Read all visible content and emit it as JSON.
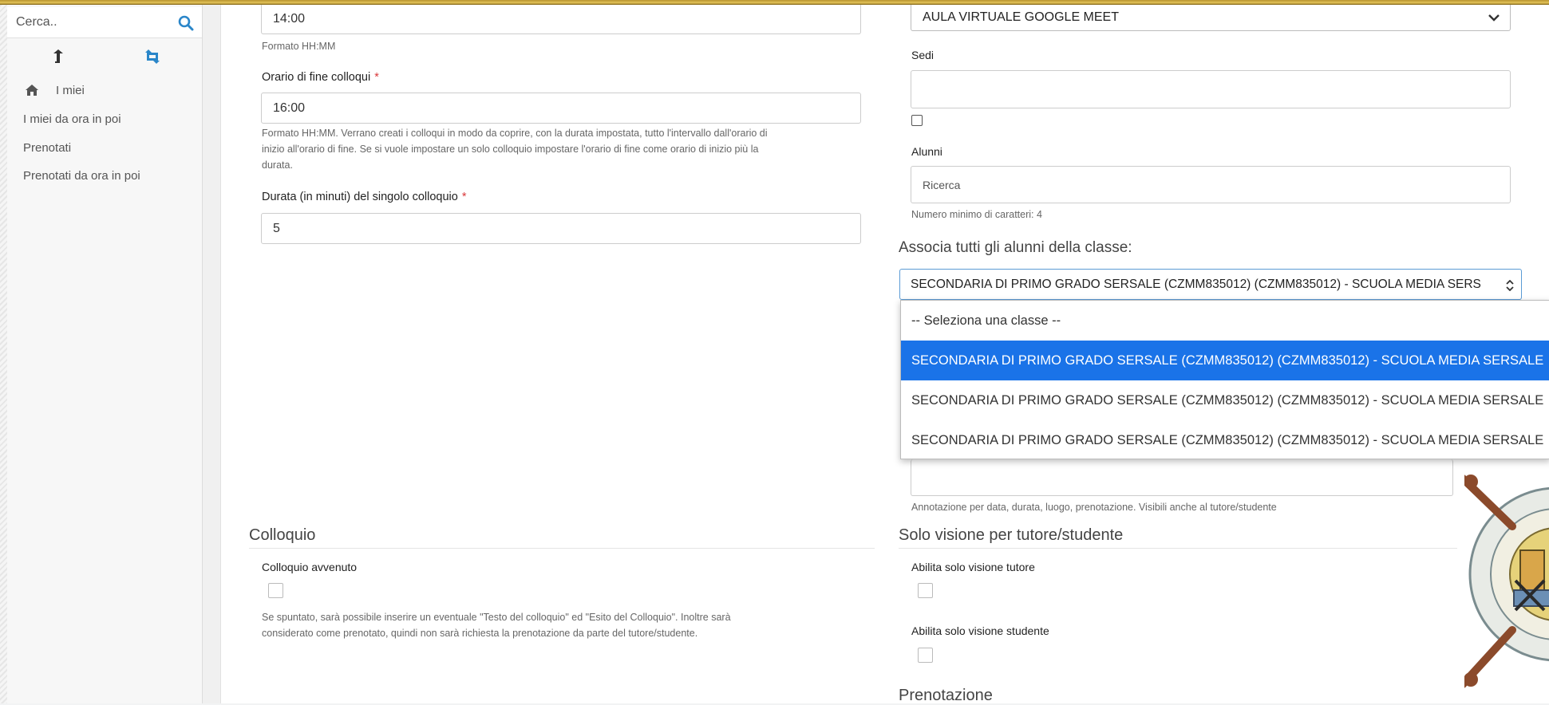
{
  "sidebar": {
    "search_placeholder": "Cerca..",
    "items": [
      {
        "label": "I miei"
      },
      {
        "label": "I miei da ora in poi"
      },
      {
        "label": "Prenotati"
      },
      {
        "label": "Prenotati da ora in poi"
      }
    ]
  },
  "left_form": {
    "start_time_value": "14:00",
    "start_time_hint": "Formato HH:MM",
    "end_time_label": "Orario di fine colloqui",
    "end_time_value": "16:00",
    "end_time_hint_1": "Formato HH:MM. Verrano creati i colloqui in modo da coprire, con la durata impostata, tutto l'intervallo dall'orario di",
    "end_time_hint_2": "inizio all'orario di fine. Se si vuole impostare un solo colloquio impostare l'orario di fine come orario di inizio più la",
    "end_time_hint_3": "durata.",
    "duration_label": "Durata (in minuti) del singolo colloquio",
    "duration_value": "5",
    "required_mark": "*"
  },
  "colloquio_section": {
    "title": "Colloquio",
    "done_label": "Colloquio avvenuto",
    "done_hint_1": "Se spuntato, sarà possibile inserire un eventuale \"Testo del colloquio\" ed \"Esito del Colloquio\". Inoltre sarà",
    "done_hint_2": "considerato come prenotato, quindi non sarà richiesta la prenotazione da parte del tutore/studente."
  },
  "right_form": {
    "location_select_value": "AULA VIRTUALE GOOGLE MEET",
    "sedi_label": "Sedi",
    "alunni_label": "Alunni",
    "alunni_placeholder": "Ricerca",
    "alunni_hint": "Numero minimo di caratteri: 4",
    "class_label": "Associa tutti gli alunni della classe:",
    "class_select_value": "SECONDARIA DI PRIMO GRADO SERSALE (CZMM835012) (CZMM835012) - SCUOLA MEDIA SERS",
    "class_options": [
      "-- Seleziona una classe --",
      "SECONDARIA DI PRIMO GRADO SERSALE (CZMM835012) (CZMM835012) - SCUOLA MEDIA SERSALE",
      "SECONDARIA DI PRIMO GRADO SERSALE (CZMM835012) (CZMM835012) - SCUOLA MEDIA SERSALE",
      "SECONDARIA DI PRIMO GRADO SERSALE (CZMM835012) (CZMM835012) - SCUOLA MEDIA SERSALE"
    ],
    "annotation_hint": "Annotazione per data, durata, luogo, prenotazione. Visibili anche al tutore/studente",
    "visibility_title": "Solo visione per tutore/studente",
    "tutor_only_label": "Abilita solo visione tutore",
    "student_only_label": "Abilita solo visione studente",
    "booking_title": "Prenotazione"
  },
  "colors": {
    "selected_option": "#1a73e8",
    "required": "#d9383a",
    "search_icon": "#2a86c9"
  }
}
